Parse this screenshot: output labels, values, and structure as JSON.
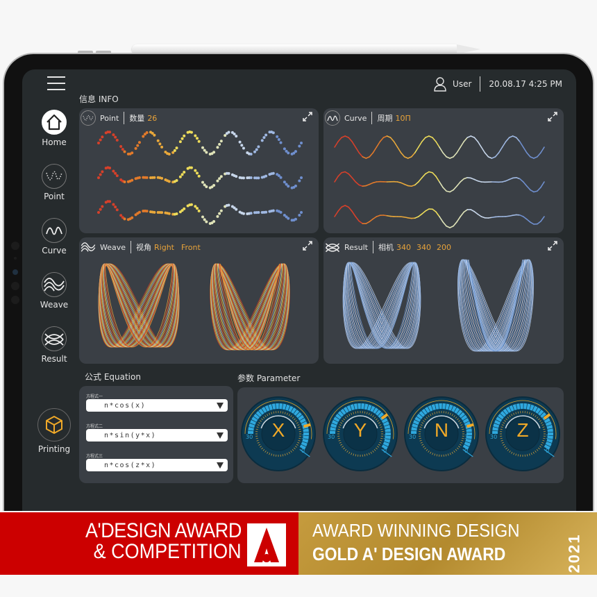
{
  "app": {
    "header": {
      "user_label": "User",
      "datetime": "20.08.17 4:25 PM"
    },
    "info_label": "信息 INFO",
    "sidebar": {
      "items": [
        {
          "label": "Home",
          "icon": "home-icon",
          "active": true
        },
        {
          "label": "Point",
          "icon": "point-wave-icon"
        },
        {
          "label": "Curve",
          "icon": "curve-wave-icon"
        },
        {
          "label": "Weave",
          "icon": "weave-icon"
        },
        {
          "label": "Result",
          "icon": "result-icon"
        }
      ],
      "printing": {
        "label": "Printing",
        "icon": "cube-icon"
      }
    },
    "panels": {
      "point": {
        "title": "Point",
        "param_label": "数量",
        "param_value": "26"
      },
      "curve": {
        "title": "Curve",
        "param_label": "周期",
        "param_value": "10Π"
      },
      "weave": {
        "title": "Weave",
        "param_label": "视角",
        "param_values": [
          "Right",
          "Front"
        ]
      },
      "result": {
        "title": "Result",
        "param_label": "相机",
        "param_values": [
          "340",
          "340",
          "200"
        ]
      }
    },
    "equation": {
      "label": "公式 Equation",
      "fields": [
        {
          "label": "方程式一",
          "value": "n*cos(x)"
        },
        {
          "label": "方程式二",
          "value": "n*sin(y*x)"
        },
        {
          "label": "方程式三",
          "value": "n*cos(z*x)"
        }
      ]
    },
    "parameter": {
      "label": "参数 Parameter",
      "dials": [
        {
          "name": "X",
          "min": "0",
          "max": "30",
          "mark": "3",
          "pointer_fraction": 0.1
        },
        {
          "name": "Y",
          "min": "0",
          "max": "30",
          "mark": "3",
          "pointer_fraction": 0.22
        },
        {
          "name": "N",
          "min": "0",
          "max": "30",
          "mark": "3",
          "pointer_fraction": 0.1
        },
        {
          "name": "Z",
          "min": "0",
          "max": "30",
          "mark": "3",
          "pointer_fraction": 0.22
        }
      ]
    },
    "colors": {
      "accent": "#e8a33a",
      "dial_blue": "#2fa8de",
      "dial_bg": "#0d3a52",
      "panel_bg": "#3a3f45",
      "screen_bg": "#262b2d"
    }
  },
  "banner": {
    "left_line1": "A'DESIGN AWARD",
    "left_line2": "& COMPETITION",
    "right_line1": "AWARD WINNING DESIGN",
    "right_line2": "GOLD A' DESIGN AWARD",
    "year": "2021",
    "colors": {
      "red": "#cc0000",
      "gold": "#c59b3e"
    }
  }
}
